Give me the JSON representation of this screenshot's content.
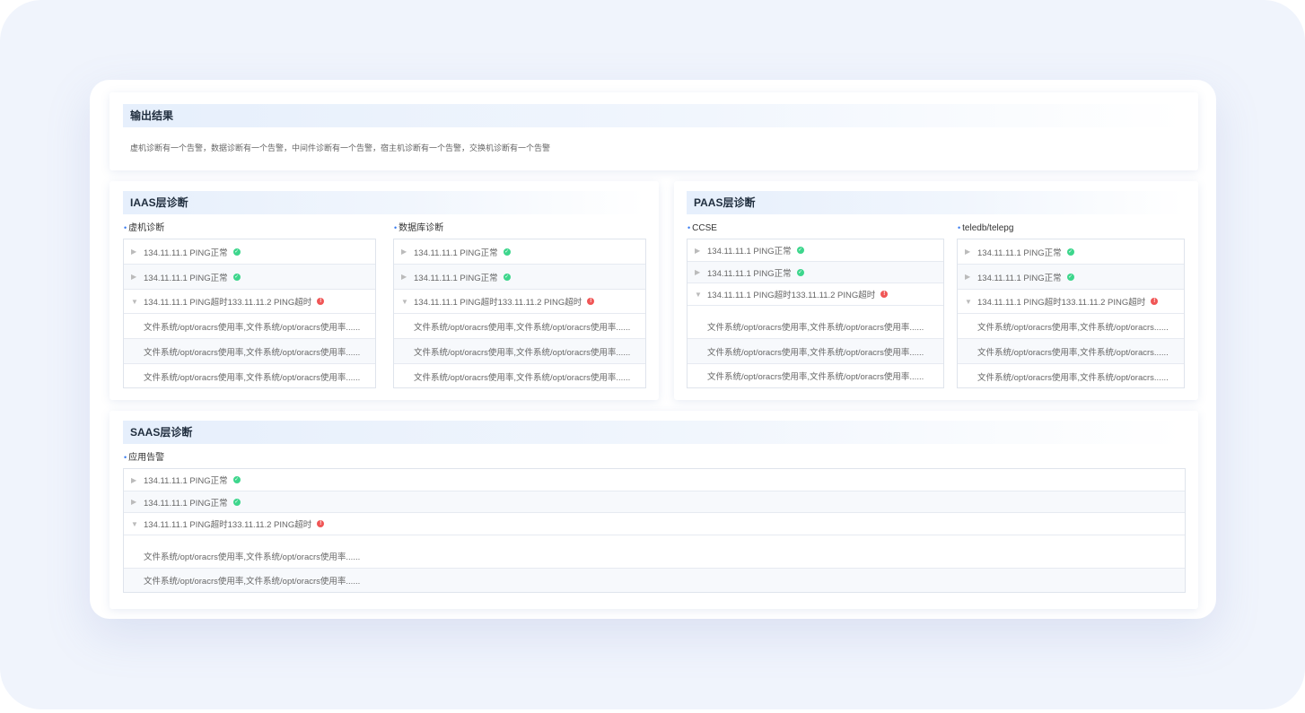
{
  "output": {
    "title": "输出结果",
    "text": "虚机诊断有一个告警，数据诊断有一个告警，中间件诊断有一个告警，宿主机诊断有一个告警，交换机诊断有一个告警"
  },
  "iaas": {
    "title": "IAAS层诊断",
    "groups": [
      {
        "label": "虚机诊断",
        "rows": [
          "134.11.11.1 PING正常",
          "134.11.11.1 PING正常",
          "134.11.11.1 PING超时133.11.11.2 PING超时"
        ],
        "details": [
          "文件系统/opt/oracrs使用率,文件系统/opt/oracrs使用率......",
          "文件系统/opt/oracrs使用率,文件系统/opt/oracrs使用率......",
          "文件系统/opt/oracrs使用率,文件系统/opt/oracrs使用率......"
        ]
      },
      {
        "label": "数据库诊断",
        "rows": [
          "134.11.11.1 PING正常",
          "134.11.11.1 PING正常",
          "134.11.11.1 PING超时133.11.11.2 PING超时"
        ],
        "details": [
          "文件系统/opt/oracrs使用率,文件系统/opt/oracrs使用率......",
          "文件系统/opt/oracrs使用率,文件系统/opt/oracrs使用率......",
          "文件系统/opt/oracrs使用率,文件系统/opt/oracrs使用率......"
        ]
      }
    ]
  },
  "paas": {
    "title": "PAAS层诊断",
    "groups": [
      {
        "label": "CCSE",
        "rows": [
          "134.11.11.1 PING正常",
          "134.11.11.1 PING正常",
          "134.11.11.1 PING超时133.11.11.2 PING超时"
        ],
        "details": [
          "文件系统/opt/oracrs使用率,文件系统/opt/oracrs使用率......",
          "文件系统/opt/oracrs使用率,文件系统/opt/oracrs使用率......",
          "文件系统/opt/oracrs使用率,文件系统/opt/oracrs使用率......"
        ]
      },
      {
        "label": "teledb/telepg",
        "rows": [
          "134.11.11.1 PING正常",
          "134.11.11.1 PING正常",
          "134.11.11.1 PING超时133.11.11.2 PING超时"
        ],
        "details": [
          "文件系统/opt/oracrs使用率,文件系统/opt/oracrs......",
          "文件系统/opt/oracrs使用率,文件系统/opt/oracrs......",
          "文件系统/opt/oracrs使用率,文件系统/opt/oracrs......"
        ]
      }
    ]
  },
  "saas": {
    "title": "SAAS层诊断",
    "groups": [
      {
        "label": "应用告警",
        "rows": [
          "134.11.11.1 PING正常",
          "134.11.11.1 PING正常",
          "134.11.11.1 PING超时133.11.11.2 PING超时"
        ],
        "details": [
          "文件系统/opt/oracrs使用率,文件系统/opt/oracrs使用率......",
          "文件系统/opt/oracrs使用率,文件系统/opt/oracrs使用率......"
        ]
      }
    ]
  },
  "icons": {
    "ok": "check-circle-icon",
    "error": "error-circle-icon",
    "collapsed": "caret-right-icon",
    "expanded": "caret-down-icon"
  },
  "colors": {
    "accent": "#3a7cf0",
    "ok": "#3dd68c",
    "error": "#f05656",
    "title_bg": "#e6effc"
  }
}
